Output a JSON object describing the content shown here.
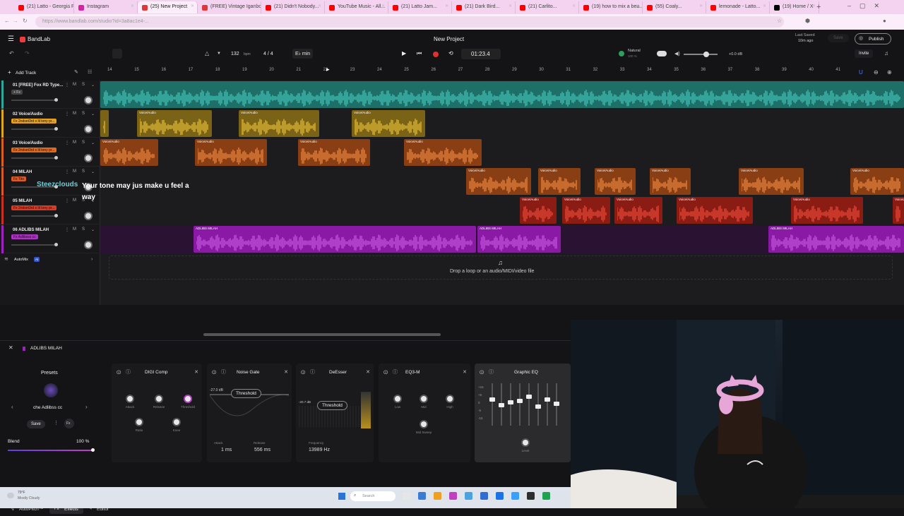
{
  "browser": {
    "tabs": [
      {
        "label": "(21) Latto - Georgia Pe...",
        "color": "#ff0000"
      },
      {
        "label": "Instagram",
        "color": "#d6249f"
      },
      {
        "label": "(25) New Project",
        "color": "#e03838"
      },
      {
        "label": "(FREE) Vintage Iganbo...",
        "color": "#e03838"
      },
      {
        "label": "(21) Didn't Nobody...",
        "color": "#ff0000"
      },
      {
        "label": "YouTube Music - All...",
        "color": "#ff0000"
      },
      {
        "label": "(21) Latto Jam...",
        "color": "#ff0000"
      },
      {
        "label": "(21) Dark Bird...",
        "color": "#ff0000"
      },
      {
        "label": "(21) Carlito...",
        "color": "#ff0000"
      },
      {
        "label": "(19) how to mix a bea...",
        "color": "#ff0000"
      },
      {
        "label": "(55) Coaly...",
        "color": "#ff0000"
      },
      {
        "label": "lemonade - Latto...",
        "color": "#ff0000"
      },
      {
        "label": "(19) Home / X",
        "color": "#000000"
      }
    ],
    "url": "https://www.bandlab.com/studio?id=3a8ac1e4-..."
  },
  "app": {
    "logo": "BandLab",
    "project_title": "New Project",
    "tempo": "132",
    "tempo_unit": "bpm",
    "time_sig": "4 / 4",
    "key": "E♭ min",
    "time": "01:23.4",
    "last_saved": "Last Saved",
    "last_saved_ago": "10m ago",
    "save_label": "Save",
    "publish_label": "Publish",
    "invite_label": "Invite",
    "natural_label": "Natural",
    "natural_sub": "100 %",
    "master_db": "+0.0 dB",
    "add_track": "Add Track",
    "automix_label": "AutoMix",
    "automix_badge": "AI",
    "drop_text": "Drop a loop or an audio/MIDI/video file"
  },
  "ruler_ticks": [
    "14",
    "15",
    "16",
    "17",
    "18",
    "19",
    "20",
    "21",
    "22",
    "23",
    "24",
    "25",
    "26",
    "27",
    "28",
    "29",
    "30",
    "31",
    "32",
    "33",
    "34",
    "35",
    "36",
    "37",
    "38",
    "39",
    "40",
    "41"
  ],
  "tracks": [
    {
      "name": "01 [FREE] Fox RD Type...",
      "fx": "+ Fx",
      "fx_color": "#444",
      "color": "#2ea79c"
    },
    {
      "name": "02 Voice/Audio",
      "fx": "Fx 2ndset3rd x lil tony pr...",
      "fx_color": "#e8a020",
      "color": "#e0a818"
    },
    {
      "name": "03 Voice/Audio",
      "fx": "Fx 2ndset3rd x lil tony pr...",
      "fx_color": "#e06a20",
      "color": "#d8601c"
    },
    {
      "name": "04 MILAH",
      "fx": "Fx Tito",
      "fx_color": "#d85a28",
      "color": "#d85a28"
    },
    {
      "name": "05 MILAH",
      "fx": "Fx 2ndset3rd x lil tony pr...",
      "fx_color": "#d83c28",
      "color": "#c83020"
    },
    {
      "name": "06 ADLIBS MILAH",
      "fx": "Fx Adlibsss cc",
      "fx_color": "#b030c8",
      "color": "#a020c0"
    }
  ],
  "region_labels": {
    "voice": "Voice/Audio",
    "adlibs": "ADLIBS MILAH"
  },
  "overlay": {
    "user": "Steezclouds",
    "message": "Your tone may jus make u feel a way"
  },
  "bottom": {
    "track_title": "ADLIBS MILAH",
    "presets_label": "Presets",
    "preset_name": "che Adlibss cc",
    "save_label": "Save",
    "blend_label": "Blend",
    "blend_value": "100 %",
    "tabs": [
      "AutoPitch™",
      "Effects",
      "Editor"
    ],
    "effects": [
      {
        "name": "DIGI Comp",
        "knobs": [
          "Attack",
          "Release",
          "Threshold",
          "Ratio",
          "Knee"
        ]
      },
      {
        "name": "Noise Gate",
        "threshold_db": "-27.0 dB",
        "threshold_label": "Threshold",
        "attack_label": "Attack",
        "attack_val": "1 ms",
        "release_label": "Release",
        "release_val": "556 ms"
      },
      {
        "name": "DeEsser",
        "threshold_db": "-20.7 dB",
        "threshold_label": "Threshold",
        "freq_label": "Frequency",
        "freq_val": "13989 Hz"
      },
      {
        "name": "EQ3-M",
        "knobs": [
          "Low",
          "Mid",
          "High",
          "Mid Sweep"
        ]
      },
      {
        "name": "Graphic EQ",
        "level_label": "Level",
        "scale": [
          "+15",
          "+5",
          "0",
          "-5",
          "-15"
        ]
      }
    ]
  },
  "taskbar": {
    "weather_temp": "79°F",
    "weather_desc": "Mostly Cloudy",
    "search_placeholder": "Search"
  }
}
